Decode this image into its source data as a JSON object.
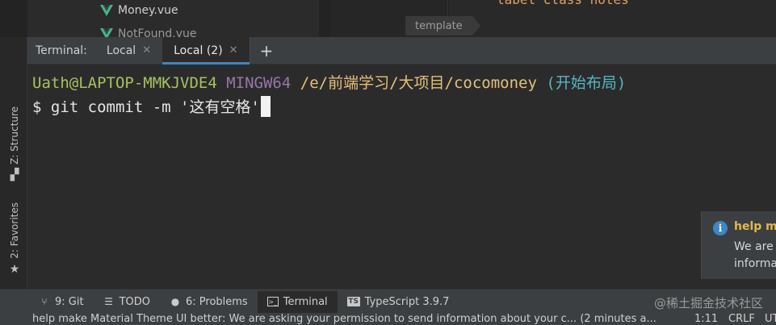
{
  "project": {
    "files": [
      {
        "name": "Money.vue",
        "icon": "vue-icon"
      },
      {
        "name": "NotFound.vue",
        "icon": "vue-icon"
      }
    ]
  },
  "editor": {
    "code_fragment": "label class  notes",
    "breadcrumb_tag": "template"
  },
  "terminal": {
    "tabbar_title": "Terminal:",
    "tabs": [
      {
        "label": "Local",
        "active": false
      },
      {
        "label": "Local (2)",
        "active": true
      }
    ],
    "add_tab_icon": "plus-icon",
    "prompt": {
      "user_host": "Uath@LAPTOP-MMKJVDE4",
      "env": "MINGW64",
      "path": "/e/前端学习/大项目/cocomoney",
      "branch": "(开始布局)"
    },
    "command_prefix": "$ ",
    "command": "git commit -m '这有空格'"
  },
  "left_rail": {
    "structure": {
      "label": "Z: Structure",
      "icon": "structure-icon"
    },
    "favorites": {
      "label": "2: Favorites",
      "icon": "star-icon"
    }
  },
  "notification": {
    "icon": "info-icon",
    "title": "help make Material Theme UI better",
    "line1": "We are asking your permission",
    "line2": "information about your configuration"
  },
  "toolbar": {
    "items": [
      {
        "label": "9: Git",
        "icon": "git-branch-icon",
        "active": false
      },
      {
        "label": "TODO",
        "icon": "todo-list-icon",
        "active": false
      },
      {
        "label": "6: Problems",
        "icon": "problems-icon",
        "active": false
      },
      {
        "label": "Terminal",
        "icon": "terminal-icon",
        "active": true
      },
      {
        "label": "TypeScript 3.9.7",
        "icon": "typescript-icon",
        "active": false
      }
    ],
    "watermark": "@稀土掘金技术社区"
  },
  "statusbar": {
    "message": "help make Material Theme UI better: We are asking your permission to send information about your c... (2 minutes a...",
    "position": "1:11",
    "line_sep": "CRLF",
    "encoding": "UT"
  },
  "colors": {
    "accent": "#3d87c5",
    "user": "#a5c261",
    "env": "#9876aa",
    "path": "#e5c07b",
    "branch": "#56b6c2",
    "notif_title": "#e5b84c"
  }
}
